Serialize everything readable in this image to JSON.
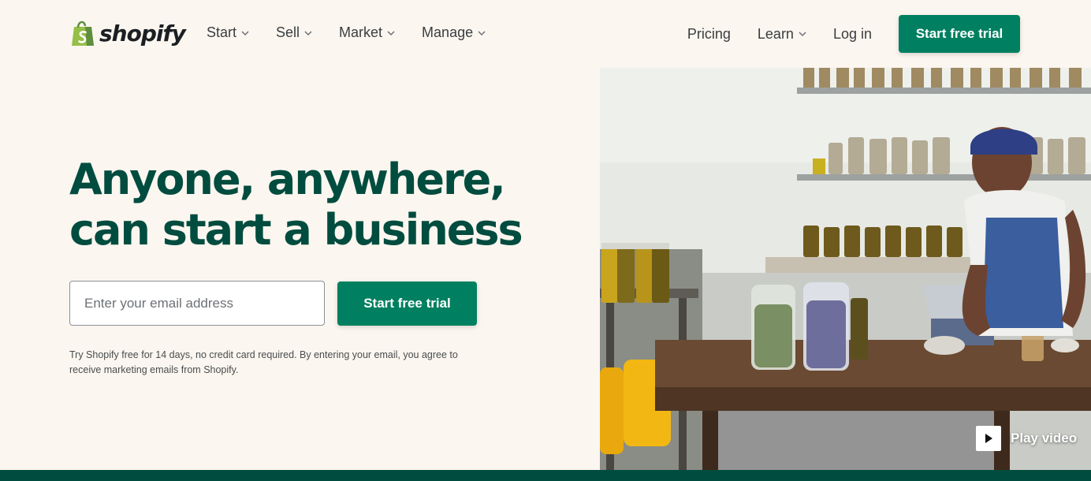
{
  "brand": {
    "name": "shopify",
    "color_green": "#008060",
    "color_dark_green": "#004c3f",
    "background": "#fbf6ef"
  },
  "nav": {
    "left": [
      {
        "label": "Start",
        "dropdown": true
      },
      {
        "label": "Sell",
        "dropdown": true
      },
      {
        "label": "Market",
        "dropdown": true
      },
      {
        "label": "Manage",
        "dropdown": true
      }
    ],
    "right": [
      {
        "label": "Pricing",
        "dropdown": false
      },
      {
        "label": "Learn",
        "dropdown": true
      },
      {
        "label": "Log in",
        "dropdown": false
      }
    ],
    "cta_label": "Start free trial"
  },
  "hero": {
    "title_line1": "Anyone, anywhere,",
    "title_line2": "can start a business",
    "email_placeholder": "Enter your email address",
    "email_value": "",
    "cta_label": "Start free trial",
    "fine_print": "Try Shopify free for 14 days, no credit card required. By entering your email, you agree to receive marketing emails from Shopify."
  },
  "media": {
    "play_label": "Play video",
    "icon": "play-icon"
  }
}
